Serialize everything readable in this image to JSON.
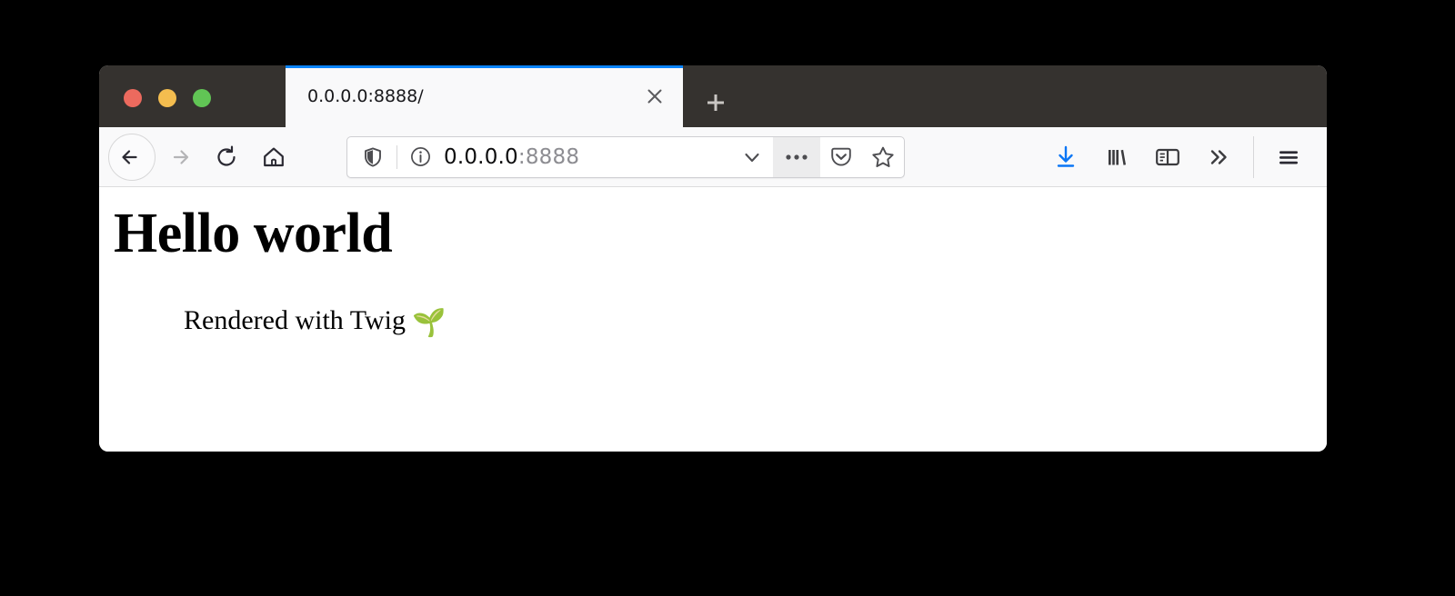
{
  "window": {
    "traffic_lights": [
      {
        "name": "close",
        "color": "#ec6a5e"
      },
      {
        "name": "minimize",
        "color": "#f4bd4f"
      },
      {
        "name": "zoom",
        "color": "#61c555"
      }
    ],
    "titlebar_color": "#35322f",
    "accent_color": "#0a84ff"
  },
  "tabs": {
    "active": {
      "title": "0.0.0.0:8888/",
      "close_icon": "close-icon"
    },
    "new_tab_icon": "plus-icon"
  },
  "toolbar": {
    "back_icon": "back-arrow-icon",
    "forward_icon": "forward-arrow-icon",
    "reload_icon": "reload-icon",
    "home_icon": "home-icon",
    "downloads_icon": "download-arrow-icon",
    "library_icon": "library-books-icon",
    "sidebar_icon": "sidebar-toggle-icon",
    "overflow_icon": "double-chevron-right-icon",
    "menu_icon": "hamburger-menu-icon",
    "downloads_color": "#0a76f5"
  },
  "urlbar": {
    "shield_icon": "tracking-protection-shield-icon",
    "identity_icon": "page-info-icon",
    "url_host": "0.0.0.0",
    "url_port": ":8888",
    "dropdown_icon": "chevron-down-icon",
    "page_actions_icon": "ellipsis-icon",
    "pocket_icon": "pocket-icon",
    "bookmark_icon": "star-icon"
  },
  "page": {
    "heading": "Hello world",
    "subtext": "Rendered with Twig",
    "emoji": "🌱",
    "emoji_name": "seedling-emoji"
  }
}
